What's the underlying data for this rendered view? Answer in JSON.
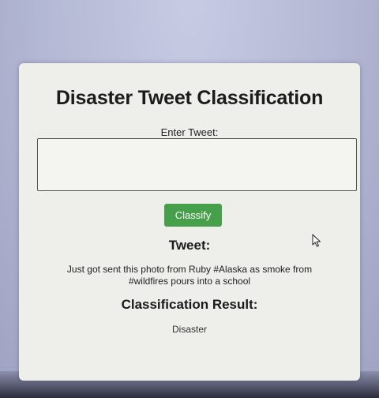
{
  "page": {
    "title": "Disaster Tweet Classification"
  },
  "form": {
    "input_label": "Enter Tweet:",
    "input_value": "",
    "classify_label": "Classify"
  },
  "tweet": {
    "heading": "Tweet:",
    "text": "Just got sent this photo from Ruby #Alaska as smoke from #wildfires pours into a school"
  },
  "result": {
    "heading": "Classification Result:",
    "value": "Disaster"
  },
  "colors": {
    "button": "#45a049",
    "card": "#eeeeea",
    "background": "#b9bdd6"
  },
  "icons": {
    "cursor": "mouse-pointer-icon"
  }
}
